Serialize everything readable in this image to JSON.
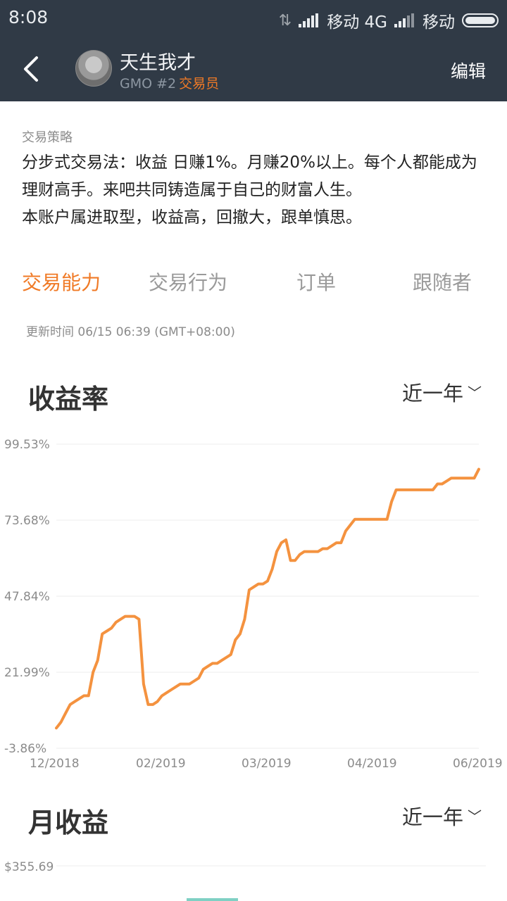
{
  "status_bar": {
    "time": "8:08",
    "carrier1": "移动 4G",
    "carrier2": "移动"
  },
  "header": {
    "back_icon": "chevron-left-icon",
    "trader_name": "天生我才",
    "rank": "GMO #2",
    "role": "交易员",
    "edit_label": "编辑"
  },
  "strategy": {
    "label": "交易策略",
    "lines": [
      "分步式交易法：收益 日赚1%。月赚20%以上。每个人都能成为",
      "理财高手。来吧共同铸造属于自己的财富人生。",
      "本账户属进取型，收益高，回撤大，跟单慎思。"
    ]
  },
  "tabs": [
    {
      "label": "交易能力",
      "active": true
    },
    {
      "label": "交易行为",
      "active": false
    },
    {
      "label": "订单",
      "active": false
    },
    {
      "label": "跟随者",
      "active": false
    }
  ],
  "update_time": "更新时间 06/15 06:39 (GMT+08:00)",
  "returns_section": {
    "title": "收益率",
    "range": "近一年"
  },
  "monthly_section": {
    "title": "月收益",
    "range": "近一年",
    "first_tick": "$355.69"
  },
  "colors": {
    "accent": "#f07a26",
    "header_bg": "#303a46",
    "line": "#f4923f"
  },
  "chart_data": {
    "type": "line",
    "title": "收益率",
    "y_ticks": [
      "99.53%",
      "73.68%",
      "47.84%",
      "21.99%",
      "-3.86%"
    ],
    "ylim": [
      -3.86,
      99.53
    ],
    "x_ticks": [
      "12/2018",
      "02/2019",
      "03/2019",
      "04/2019",
      "06/2019"
    ],
    "series": [
      {
        "values": [
          3,
          5,
          8,
          11,
          12,
          13,
          14,
          14,
          22,
          26,
          35,
          36,
          37,
          39,
          40,
          41,
          41,
          41,
          40,
          18,
          11,
          11,
          12,
          14,
          15,
          16,
          17,
          18,
          18,
          18,
          19,
          20,
          23,
          24,
          25,
          25,
          26,
          27,
          28,
          33,
          35,
          40,
          50,
          51,
          52,
          52,
          53,
          57,
          63,
          66,
          67,
          60,
          60,
          62,
          63,
          63,
          63,
          63,
          64,
          64,
          65,
          66,
          66,
          70,
          72,
          74,
          74,
          74,
          74,
          74,
          74,
          74,
          74,
          80,
          84,
          84,
          84,
          84,
          84,
          84,
          84,
          84,
          84,
          86,
          86,
          87,
          88,
          88,
          88,
          88,
          88,
          88,
          91
        ]
      }
    ]
  }
}
